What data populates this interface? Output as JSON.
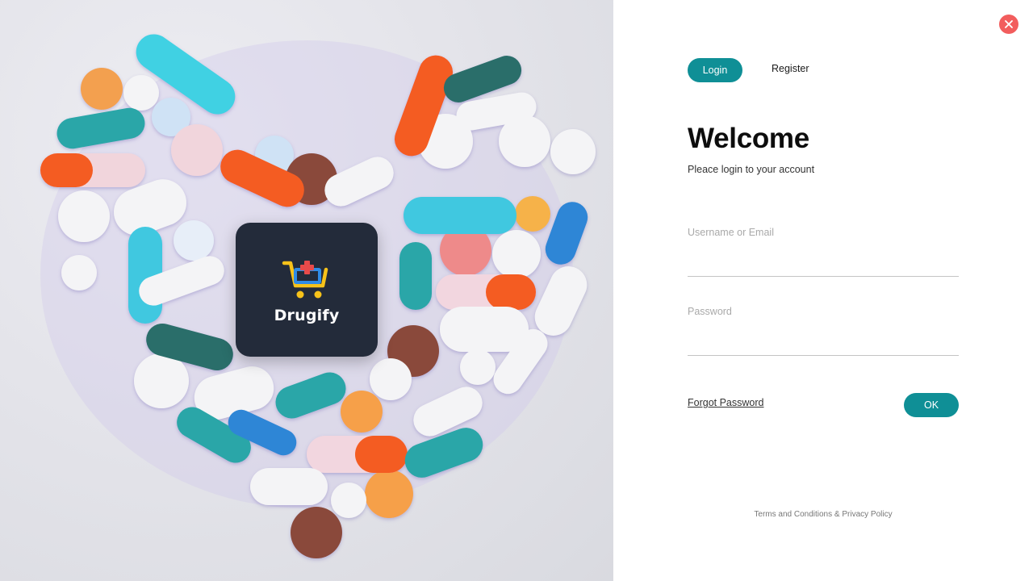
{
  "hero": {
    "image_icon": "pills-heart-photo",
    "brand": {
      "name": "Drugify",
      "logo_icon": "medical-cart-icon"
    },
    "colors": {
      "card_bg": "#232b3a",
      "logo_blue": "#2e8be6",
      "logo_yellow": "#f6c21a",
      "logo_red": "#e84a4a"
    }
  },
  "panel": {
    "close_icon": "close-icon",
    "tabs": {
      "login": "Login",
      "register": "Register"
    },
    "title": "Welcome",
    "subtitle": "Pleace login to your account",
    "fields": {
      "username": {
        "label": "Username or Email",
        "value": "",
        "placeholder": ""
      },
      "password": {
        "label": "Password",
        "value": "",
        "placeholder": ""
      }
    },
    "forgot_password": "Forgot Password",
    "submit": "OK",
    "footer": "Terms and Conditions & Privacy Policy",
    "colors": {
      "accent": "#0f8f96",
      "close": "#f25d5d"
    }
  }
}
